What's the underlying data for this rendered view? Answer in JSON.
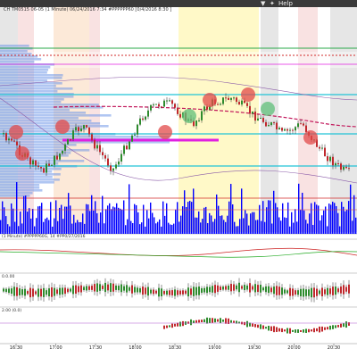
{
  "menu": {
    "help_label": "Help"
  },
  "chart": {
    "title": "CH TM0515 06-05 (1 Minute) 06/24/2016 7:34 #PPPPPP60 [0/4/2016 8:30 ]",
    "volume_panel_label": "(1 Minute) #PPPPP60G, 14 #PP0/27/2016",
    "osc1_label": "0.0.00",
    "osc2_label": "2.00 (0.0)"
  },
  "time_axis": [
    "16:30",
    "17:00",
    "17:30",
    "18:00",
    "18:30",
    "19:00",
    "19:30",
    "20:00",
    "20:30"
  ],
  "colors": {
    "menu_bg": "#3a3a3a",
    "up_candle": "#2e8b2e",
    "down_candle": "#c0282d",
    "volume": "#0000ff",
    "profile": "#6f97e8",
    "cyan_line": "#22c4d6",
    "magenta_line": "#e020e0",
    "green_line": "#2aa84a",
    "red_line": "#d22a2a",
    "dashed_line": "#c2185b",
    "yellow_band": "#fff6b0",
    "orange_band": "#fbe0c8",
    "pink_band": "#f6d6d6",
    "gray_band": "#dcdcdc"
  },
  "icons": [
    "dropdown-arrow-icon",
    "help-icon"
  ]
}
